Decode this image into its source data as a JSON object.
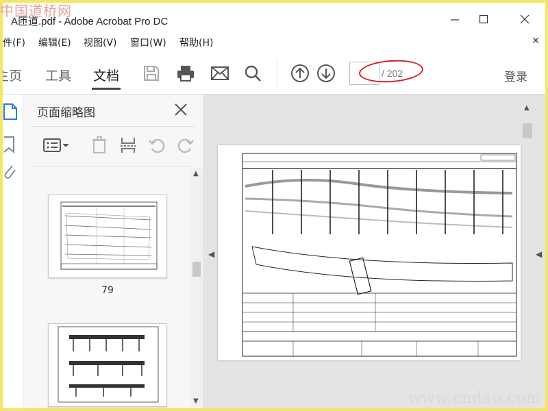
{
  "watermark_top": "中国道桥网",
  "watermark_bottom": "www.cndao.com",
  "window": {
    "title": "A匝道.pdf - Adobe Acrobat Pro DC"
  },
  "menu": [
    "件(F)",
    "编辑(E)",
    "视图(V)",
    "窗口(W)",
    "帮助(H)"
  ],
  "tabs": [
    {
      "label": "主页",
      "active": false
    },
    {
      "label": "工具",
      "active": false
    },
    {
      "label": "文档",
      "active": true
    }
  ],
  "page_nav": {
    "current": "",
    "total_text": "/ 202"
  },
  "login": "登录",
  "panel": {
    "title": "页面缩略图",
    "thumbnails": [
      {
        "page": "79"
      },
      {
        "page": ""
      }
    ]
  },
  "colors": {
    "highlight_ellipse": "#d82020",
    "page_bg": "#e4e4e4",
    "frame": "#f5e66a"
  }
}
